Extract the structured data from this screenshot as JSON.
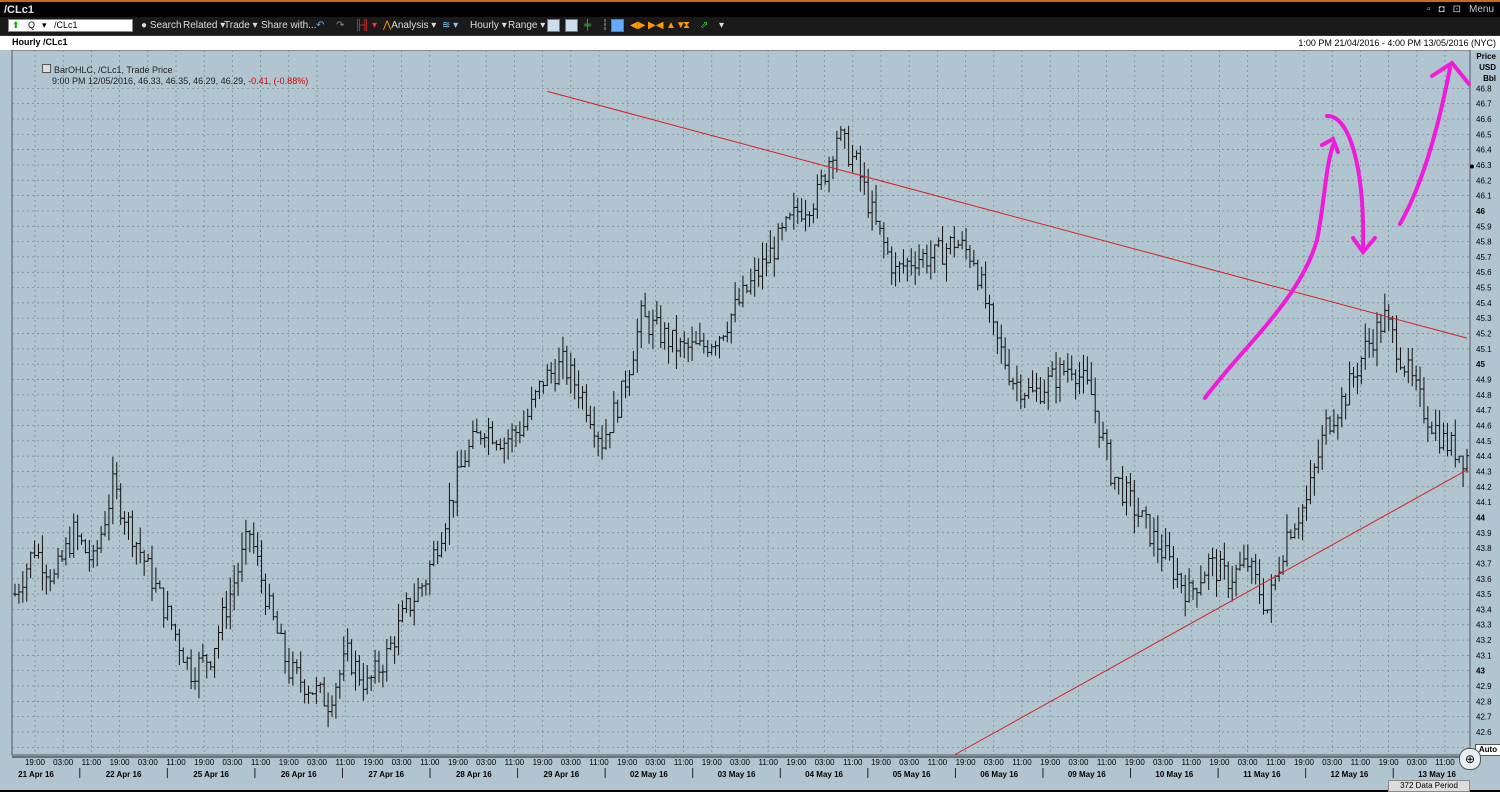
{
  "window": {
    "title": "/CLc1",
    "menu_label": "Menu"
  },
  "toolbar": {
    "symbol_q": "Q",
    "symbol_value": "/CLc1",
    "search": "Search",
    "related": "Related",
    "trade": "Trade",
    "share": "Share with...",
    "analysis": "Analysis",
    "interval": "Hourly",
    "range": "Range"
  },
  "header": {
    "left": "Hourly /CLc1",
    "right": "1:00 PM 21/04/2016 - 4:00 PM 13/05/2016 (NYC)"
  },
  "legend": {
    "line1": "BarOHLC, /CLc1, Trade Price",
    "line2": "9:00 PM 12/05/2016, 46.33, 46.35, 46.29, 46.29,",
    "change": "-0.41, (-0.88%)"
  },
  "axis": {
    "price_title_1": "Price",
    "price_title_2": "USD",
    "price_title_3": "Bbl",
    "auto": "Auto"
  },
  "status": {
    "data_period": "372 Data Period"
  },
  "colors": {
    "background": "#b1c5d0",
    "bars": "#111111",
    "trendline": "#d82020",
    "annotation": "#ee1bd8"
  },
  "chart_data": {
    "type": "bar",
    "series": [
      {
        "name": "BarOHLC, /CLc1, Trade Price"
      }
    ],
    "ylim": [
      42.45,
      47.05
    ],
    "y_ticks": [
      42.5,
      42.6,
      42.7,
      42.8,
      42.9,
      43,
      43.1,
      43.2,
      43.3,
      43.4,
      43.5,
      43.6,
      43.7,
      43.8,
      43.9,
      44,
      44.1,
      44.2,
      44.3,
      44.4,
      44.5,
      44.6,
      44.7,
      44.8,
      44.9,
      45,
      45.1,
      45.2,
      45.3,
      45.4,
      45.5,
      45.6,
      45.7,
      45.8,
      45.9,
      46,
      46.1,
      46.2,
      46.3,
      46.4,
      46.5,
      46.6,
      46.7,
      46.8
    ],
    "y_major": [
      43,
      44,
      45,
      46
    ],
    "time_labels": [
      "19:00",
      "03:00",
      "11:00",
      "19:00",
      "03:00",
      "11:00",
      "19:00",
      "03:00",
      "11:00",
      "19:00",
      "03:00",
      "11:00",
      "19:00",
      "03:00",
      "11:00",
      "19:00",
      "03:00",
      "11:00",
      "19:00",
      "03:00",
      "11:00",
      "19:00",
      "03:00",
      "11:00",
      "19:00",
      "03:00",
      "11:00",
      "19:00",
      "03:00",
      "11:00",
      "19:00",
      "03:00",
      "11:00",
      "19:00",
      "03:00",
      "11:00",
      "19:00",
      "03:00",
      "11:00",
      "19:00",
      "03:00",
      "11:00",
      "19:00",
      "03:00",
      "11:00",
      "19:00",
      "03:00",
      "11:00",
      "19:00",
      "03:00",
      "11:00"
    ],
    "date_labels": [
      "21 Apr 16",
      "22 Apr 16",
      "25 Apr 16",
      "26 Apr 16",
      "27 Apr 16",
      "28 Apr 16",
      "29 Apr 16",
      "02 May 16",
      "03 May 16",
      "04 May 16",
      "05 May 16",
      "06 May 16",
      "09 May 16",
      "10 May 16",
      "11 May 16",
      "12 May 16",
      "13 May 16"
    ],
    "bars": 372,
    "close_path": [
      [
        0,
        43.5
      ],
      [
        5,
        43.8
      ],
      [
        10,
        43.6
      ],
      [
        15,
        43.9
      ],
      [
        20,
        43.7
      ],
      [
        25,
        44.2
      ],
      [
        30,
        43.9
      ],
      [
        35,
        43.6
      ],
      [
        40,
        43.3
      ],
      [
        45,
        43.0
      ],
      [
        50,
        43.1
      ],
      [
        55,
        43.5
      ],
      [
        60,
        43.9
      ],
      [
        65,
        43.4
      ],
      [
        70,
        43.0
      ],
      [
        75,
        42.9
      ],
      [
        80,
        42.8
      ],
      [
        85,
        43.1
      ],
      [
        90,
        42.9
      ],
      [
        95,
        43.1
      ],
      [
        100,
        43.4
      ],
      [
        105,
        43.6
      ],
      [
        110,
        44.0
      ],
      [
        115,
        44.4
      ],
      [
        120,
        44.6
      ],
      [
        125,
        44.5
      ],
      [
        130,
        44.6
      ],
      [
        135,
        44.9
      ],
      [
        140,
        45.0
      ],
      [
        145,
        44.8
      ],
      [
        150,
        44.5
      ],
      [
        155,
        44.8
      ],
      [
        160,
        45.3
      ],
      [
        165,
        45.2
      ],
      [
        170,
        45.1
      ],
      [
        175,
        45.1
      ],
      [
        180,
        45.2
      ],
      [
        185,
        45.4
      ],
      [
        190,
        45.6
      ],
      [
        195,
        45.8
      ],
      [
        200,
        46.0
      ],
      [
        205,
        46.1
      ],
      [
        210,
        46.5
      ],
      [
        215,
        46.3
      ],
      [
        220,
        45.9
      ],
      [
        225,
        45.6
      ],
      [
        230,
        45.7
      ],
      [
        235,
        45.7
      ],
      [
        240,
        45.8
      ],
      [
        245,
        45.7
      ],
      [
        250,
        45.2
      ],
      [
        255,
        44.9
      ],
      [
        260,
        44.8
      ],
      [
        265,
        44.9
      ],
      [
        270,
        45.0
      ],
      [
        275,
        44.8
      ],
      [
        280,
        44.3
      ],
      [
        285,
        44.1
      ],
      [
        290,
        43.9
      ],
      [
        295,
        43.7
      ],
      [
        300,
        43.5
      ],
      [
        305,
        43.7
      ],
      [
        310,
        43.6
      ],
      [
        315,
        43.7
      ],
      [
        320,
        43.4
      ],
      [
        325,
        43.9
      ],
      [
        330,
        44.1
      ],
      [
        335,
        44.6
      ],
      [
        340,
        44.8
      ],
      [
        345,
        45.1
      ],
      [
        350,
        45.3
      ],
      [
        355,
        45.0
      ],
      [
        360,
        44.7
      ],
      [
        365,
        44.5
      ],
      [
        370,
        44.4
      ]
    ],
    "close_path_note_omitted": "",
    "trendlines": [
      {
        "from_bar": 136,
        "from_price": 46.78,
        "to_bar": 371,
        "to_price": 45.17
      },
      {
        "from_bar": 240,
        "from_price": 42.45,
        "to_bar": 371,
        "to_price": 44.31
      }
    ]
  }
}
